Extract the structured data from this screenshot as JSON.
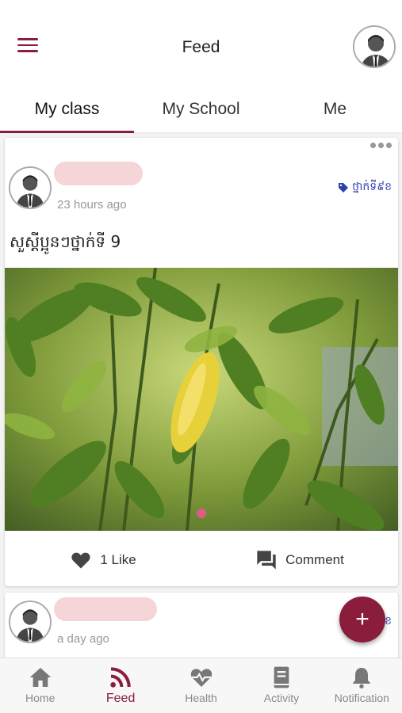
{
  "header": {
    "title": "Feed",
    "menu_icon": "hamburger-menu-icon",
    "profile_icon": "user-avatar-icon"
  },
  "tabs": [
    {
      "label": "My class",
      "active": true
    },
    {
      "label": "My School",
      "active": false
    },
    {
      "label": "Me",
      "active": false
    }
  ],
  "posts": [
    {
      "time": "23 hours ago",
      "tag": "ថ្នាក់ទី៩ខ",
      "text": "សួស្តីប្អូនៗថ្នាក់ទី 9",
      "likes": "1 Like",
      "comment_label": "Comment"
    },
    {
      "time": "a day ago",
      "tag": "ខ"
    }
  ],
  "fab": {
    "label": "+"
  },
  "bottom_nav": [
    {
      "label": "Home",
      "icon": "home-icon"
    },
    {
      "label": "Feed",
      "icon": "rss-feed-icon",
      "active": true
    },
    {
      "label": "Health",
      "icon": "heart-pulse-icon"
    },
    {
      "label": "Activity",
      "icon": "book-icon"
    },
    {
      "label": "Notification",
      "icon": "bell-icon"
    }
  ],
  "colors": {
    "accent": "#8a1c3c",
    "tag": "#2e3fb0",
    "muted": "#888888"
  }
}
